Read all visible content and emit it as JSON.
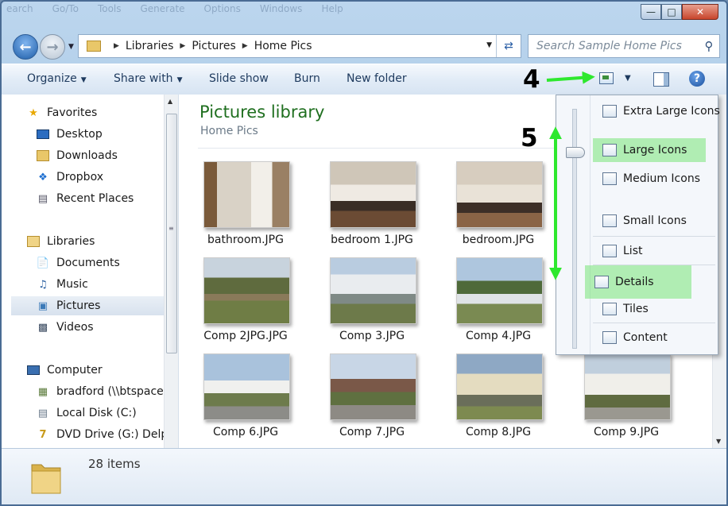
{
  "window": {
    "faded_menu": [
      "earch",
      "Go/To",
      "Tools",
      "Generate",
      "Options",
      "Windows",
      "Help"
    ]
  },
  "address": {
    "crumbs": [
      "Libraries",
      "Pictures",
      "Home Pics"
    ]
  },
  "search": {
    "placeholder": "Search Sample Home Pics"
  },
  "commands": {
    "organize": "Organize",
    "share_with": "Share with",
    "slide_show": "Slide show",
    "burn": "Burn",
    "new_folder": "New folder"
  },
  "nav": {
    "favorites": "Favorites",
    "desktop": "Desktop",
    "downloads": "Downloads",
    "dropbox": "Dropbox",
    "recent_places": "Recent Places",
    "libraries": "Libraries",
    "documents": "Documents",
    "music": "Music",
    "pictures": "Pictures",
    "videos": "Videos",
    "computer": "Computer",
    "bradford": "bradford (\\\\btspace)",
    "local_disk": "Local Disk (C:)",
    "dvd_drive": "DVD Drive (G:) Delp"
  },
  "library": {
    "title": "Pictures library",
    "subtitle": "Home Pics"
  },
  "files": [
    {
      "name": "bathroom.JPG"
    },
    {
      "name": "bedroom 1.JPG"
    },
    {
      "name": "bedroom.JPG"
    },
    {
      "name": "Comp 2JPG.JPG"
    },
    {
      "name": "Comp 3.JPG"
    },
    {
      "name": "Comp 4.JPG"
    },
    {
      "name": "Comp 6.JPG"
    },
    {
      "name": "Comp 7.JPG"
    },
    {
      "name": "Comp 8.JPG"
    },
    {
      "name": "Comp 9.JPG"
    }
  ],
  "views_menu": {
    "extra_large": "Extra Large Icons",
    "large": "Large Icons",
    "medium": "Medium Icons",
    "small": "Small Icons",
    "list": "List",
    "details": "Details",
    "tiles": "Tiles",
    "content": "Content"
  },
  "annotations": {
    "step4": "4",
    "step5": "5"
  },
  "status": {
    "items": "28 items"
  },
  "colors": {
    "library_title": "#1f6f1f",
    "annotation_arrow": "#2ee82e",
    "highlight": "#8ff08f"
  }
}
